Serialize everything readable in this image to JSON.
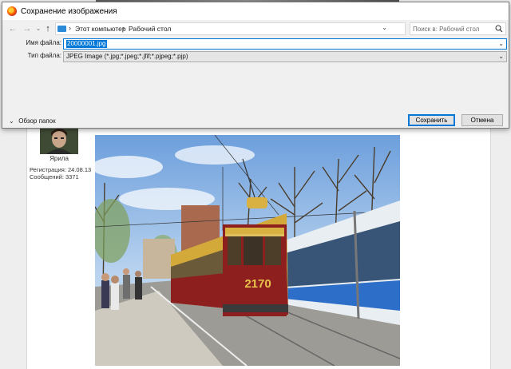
{
  "dialog": {
    "title": "Сохранение изображения",
    "breadcrumbs": [
      "Этот компьютер",
      "Рабочий стол"
    ],
    "search_placeholder": "Поиск в: Рабочий стол",
    "filename_label": "Имя файла:",
    "filename_value": "20000001.jpg",
    "filetype_label": "Тип файла:",
    "filetype_value": "JPEG Image (*.jpg;*.jpeg;*.jfif;*.pjpeg;*.pjp)",
    "browse_folders_label": "Обзор папок",
    "save_label": "Сохранить",
    "cancel_label": "Отмена"
  },
  "forum": {
    "username": "Ярила",
    "registration": "Регистрация: 24.08.13",
    "messages": "Сообщений: 3371"
  },
  "photo": {
    "tram_number": "2170"
  },
  "colors": {
    "accent": "#0078d7",
    "tram_red": "#8e1f1f",
    "tram_yellow": "#d9b042"
  },
  "icons": {
    "back": "arrow-left-icon",
    "forward": "arrow-right-icon",
    "up": "arrow-up-icon",
    "refresh": "refresh-icon",
    "search": "search-icon",
    "computer": "computer-icon",
    "app": "firefox-icon"
  }
}
